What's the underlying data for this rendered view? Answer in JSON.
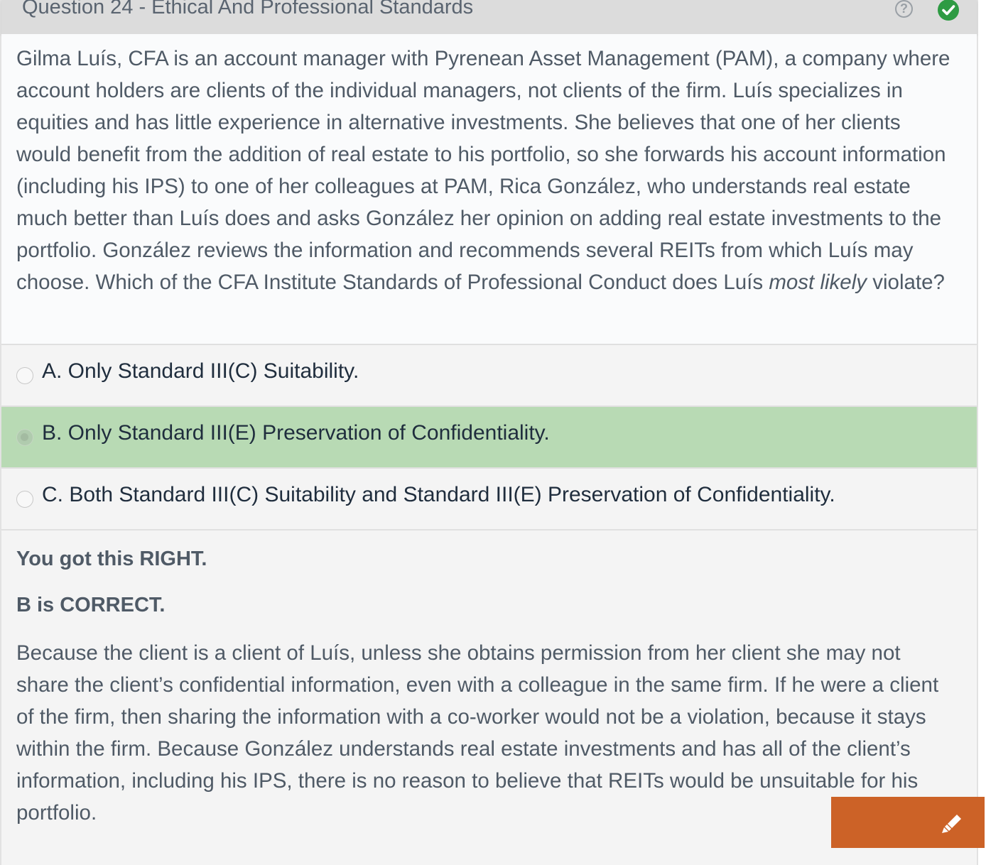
{
  "header": {
    "title": "Question 24 - Ethical And Professional Standards",
    "help_icon_glyph": "?",
    "status": "correct"
  },
  "question": {
    "text_before": "Gilma Luís, CFA is an account manager with Pyrenean Asset Management (PAM), a company where account holders are clients of the individual managers, not clients of the firm.  Luís specializes in equities and has little experience in alternative investments.  She believes that one of her clients would benefit from the addition of real estate to his portfolio, so she forwards his account information (including his IPS) to one of her colleagues at PAM, Rica González, who understands real estate much better than Luís does and asks González her opinion on adding real estate investments to the portfolio.  González reviews the information and recommends several REITs from which Luís may choose.  Which of the CFA Institute Standards of Professional Conduct does Luís ",
    "text_emphasis": "most likely",
    "text_after": " violate?"
  },
  "options": [
    {
      "label": "A. Only Standard III(C) Suitability.",
      "selected": false
    },
    {
      "label": "B. Only Standard III(E) Preservation of Confidentiality.",
      "selected": true
    },
    {
      "label": "C. Both Standard III(C) Suitability and Standard III(E) Preservation of Confidentiality.",
      "selected": false
    }
  ],
  "feedback": {
    "result": "You got this RIGHT.",
    "correct_answer": "B is CORRECT.",
    "explanation": "Because the client is a client of Luís, unless she obtains permission from her client she may not share the client’s confidential information, even with a colleague in the same firm.  If he were a client of the firm, then sharing the information with a co-worker would not be a violation, because it stays within the firm.  Because González understands real estate investments and has all of the client’s information, including his IPS, there is no reason to believe that REITs would be unsuitable for his portfolio."
  },
  "icons": {
    "help": "question-circle-icon",
    "status": "check-circle-icon",
    "highlight": "highlighter-icon"
  },
  "colors": {
    "header_bg": "#dcdcdc",
    "selected_option_bg": "#b8dab4",
    "correct_green": "#2e9b43",
    "highlight_button": "#cc6227",
    "text": "#4f5a66"
  }
}
